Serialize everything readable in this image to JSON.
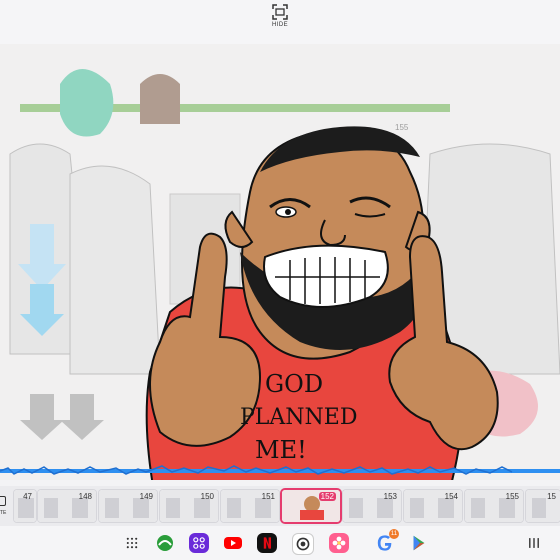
{
  "top_bar": {
    "hide_label": "HIDE",
    "hide_icon": "screen-capture-icon"
  },
  "canvas": {
    "shirt_text": [
      "GOD",
      "PLANNED",
      "ME!"
    ],
    "shirt_color": "#e8463e",
    "skin_color": "#c58a5a",
    "overlay_text": "155"
  },
  "timeline": {
    "left_tool_label": "TE",
    "frames": [
      {
        "num": "47"
      },
      {
        "num": "148"
      },
      {
        "num": "149"
      },
      {
        "num": "150"
      },
      {
        "num": "151"
      },
      {
        "num": "152"
      },
      {
        "num": "153"
      },
      {
        "num": "154"
      },
      {
        "num": "155"
      },
      {
        "num": "15"
      }
    ],
    "current_frame": "152"
  },
  "dock": {
    "items": [
      {
        "name": "app-drawer-icon"
      },
      {
        "name": "game-app-icon"
      },
      {
        "name": "multi-app-icon"
      },
      {
        "name": "youtube-icon"
      },
      {
        "name": "netflix-icon"
      },
      {
        "name": "screen-recorder-icon"
      },
      {
        "name": "flower-app-icon"
      },
      {
        "name": "google-icon",
        "badge": "11"
      },
      {
        "name": "play-store-icon"
      },
      {
        "name": "recent-apps-icon"
      }
    ]
  },
  "colors": {
    "accent": "#e53c6e",
    "waveform": "#2e8ff0"
  }
}
